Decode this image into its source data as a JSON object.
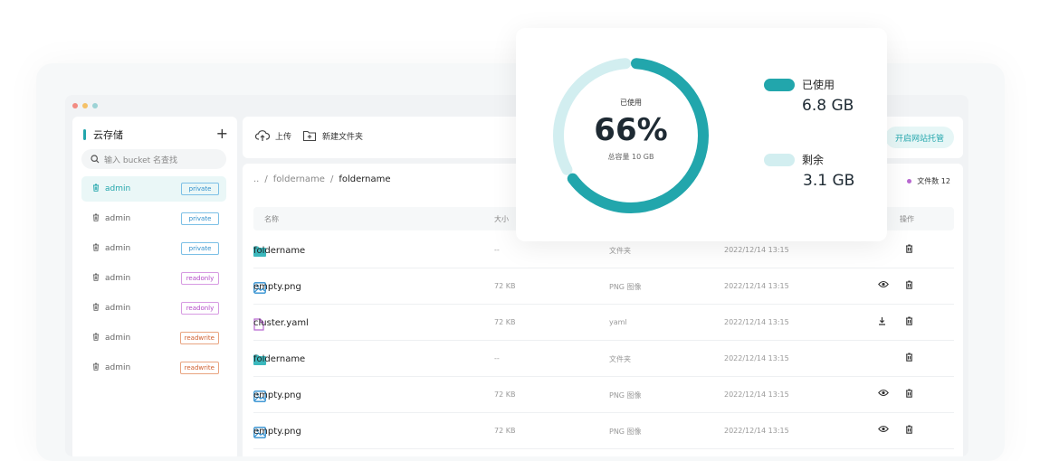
{
  "colors": {
    "accent": "#22a6ac",
    "accent_light": "#d2eef0"
  },
  "sidebar": {
    "title": "云存储",
    "search_placeholder": "输入 bucket 名查找",
    "items": [
      {
        "label": "admin",
        "tag": "private"
      },
      {
        "label": "admin",
        "tag": "private"
      },
      {
        "label": "admin",
        "tag": "private"
      },
      {
        "label": "admin",
        "tag": "readonly"
      },
      {
        "label": "admin",
        "tag": "readonly"
      },
      {
        "label": "admin",
        "tag": "readwrite"
      },
      {
        "label": "admin",
        "tag": "readwrite"
      }
    ]
  },
  "toolbar": {
    "upload": "上传",
    "new_folder": "新建文件夹",
    "host": "开启网站托管"
  },
  "breadcrumb": {
    "root": "..",
    "sep": "/",
    "parent": "foldername",
    "current": "foldername"
  },
  "file_count": "文件数 12",
  "table": {
    "headers": {
      "name": "名称",
      "size": "大小",
      "action": "操作"
    },
    "rows": [
      {
        "name": "foldername",
        "icon": "folder-icon",
        "size": "--",
        "type": "文件夹",
        "date": "2022/12/14 13:15",
        "actions": [
          "delete"
        ]
      },
      {
        "name": "empty.png",
        "icon": "image-icon",
        "size": "72 KB",
        "type": "PNG 图像",
        "date": "2022/12/14 13:15",
        "actions": [
          "view",
          "delete"
        ]
      },
      {
        "name": "cluster.yaml",
        "icon": "file-icon",
        "size": "72 KB",
        "type": "yaml",
        "date": "2022/12/14 13:15",
        "actions": [
          "download",
          "delete"
        ]
      },
      {
        "name": "foldername",
        "icon": "folder-icon",
        "size": "--",
        "type": "文件夹",
        "date": "2022/12/14 13:15",
        "actions": [
          "delete"
        ]
      },
      {
        "name": "empty.png",
        "icon": "image-icon",
        "size": "72 KB",
        "type": "PNG 图像",
        "date": "2022/12/14 13:15",
        "actions": [
          "view",
          "delete"
        ]
      },
      {
        "name": "empty.png",
        "icon": "image-icon",
        "size": "72 KB",
        "type": "PNG 图像",
        "date": "2022/12/14 13:15",
        "actions": [
          "view",
          "delete"
        ]
      }
    ]
  },
  "storage": {
    "used_label": "已使用",
    "percent": "66%",
    "used_fraction": 0.66,
    "total": "总容量 10 GB",
    "legend_used": "已使用",
    "legend_used_value": "6.8 GB",
    "legend_free": "剩余",
    "legend_free_value": "3.1 GB"
  }
}
